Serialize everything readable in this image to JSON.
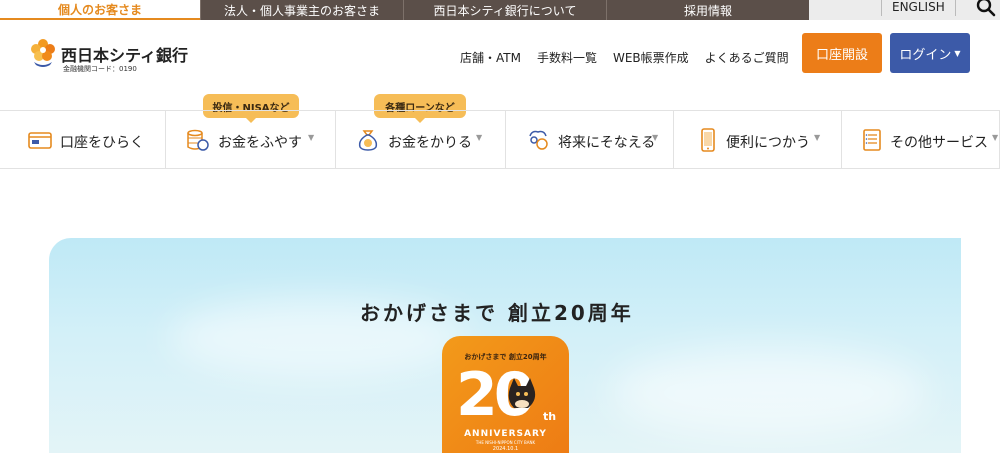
{
  "top_tabs": {
    "personal": "個人のお客さま",
    "corporate": "法人・個人事業主のお客さま",
    "about": "西日本シティ銀行について",
    "recruit": "採用情報",
    "english": "ENGLISH"
  },
  "logo": {
    "name": "西日本シティ銀行",
    "code": "金融機関コード：0190"
  },
  "header_nav": [
    "店舗・ATM",
    "手数料一覧",
    "WEB帳票作成",
    "よくあるご質問"
  ],
  "buttons": {
    "open_account": "口座開設",
    "login": "ログイン"
  },
  "bubbles": {
    "invest": "投信・NISAなど",
    "loan": "各種ローンなど"
  },
  "main_nav": [
    {
      "label": "口座をひらく",
      "icon": "passbook-icon"
    },
    {
      "label": "お金をふやす",
      "icon": "coins-icon"
    },
    {
      "label": "お金をかりる",
      "icon": "money-bag-icon"
    },
    {
      "label": "将来にそなえる",
      "icon": "future-icon"
    },
    {
      "label": "便利につかう",
      "icon": "smartphone-icon"
    },
    {
      "label": "その他サービス",
      "icon": "document-list-icon"
    }
  ],
  "hero": {
    "title": "おかげさまで 創立20周年",
    "badge_top": "おかげさまで 創立20周年",
    "badge_number": "20",
    "badge_suffix": "th",
    "badge_anniversary": "ANNIVERSARY",
    "badge_bank": "THE NISHI-NIPPON CITY BANK",
    "badge_date": "2024.10.1"
  },
  "colors": {
    "accent_orange": "#ec7d18",
    "login_blue": "#3c5aa8",
    "topbar_brown": "#5b4f49",
    "bubble_yellow": "#f6bd57"
  }
}
